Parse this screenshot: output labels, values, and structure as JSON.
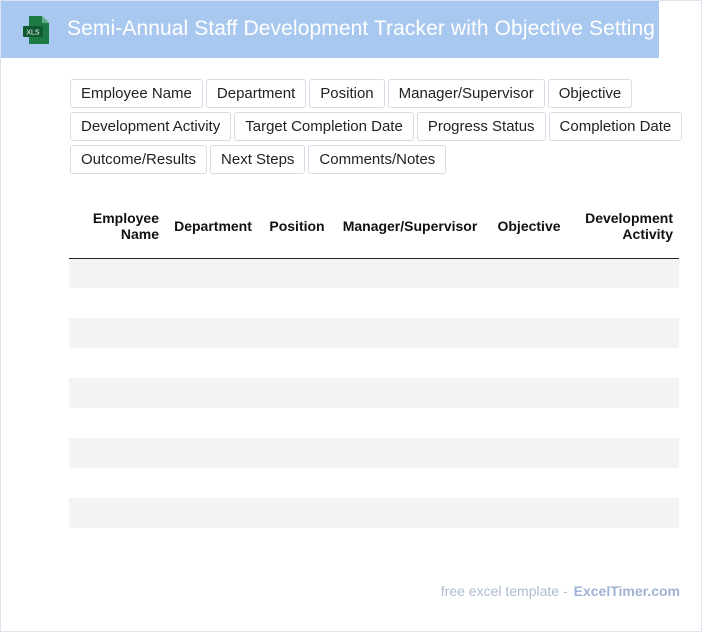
{
  "header": {
    "title": "Semi-Annual Staff Development Tracker with Objective Setting",
    "icon_label": "XLS",
    "icon": "excel-file-icon",
    "bg_color": "#a9c8ef"
  },
  "fields": [
    "Employee Name",
    "Department",
    "Position",
    "Manager/Supervisor",
    "Objective",
    "Development Activity",
    "Target Completion Date",
    "Progress Status",
    "Completion Date",
    "Outcome/Results",
    "Next Steps",
    "Comments/Notes"
  ],
  "table": {
    "columns": [
      "Employee Name",
      "Department",
      "Position",
      "Manager/Supervisor",
      "Objective",
      "Development Activity"
    ],
    "row_count": 10
  },
  "footer": {
    "text": "free excel template -",
    "brand": "ExcelTimer.com"
  }
}
